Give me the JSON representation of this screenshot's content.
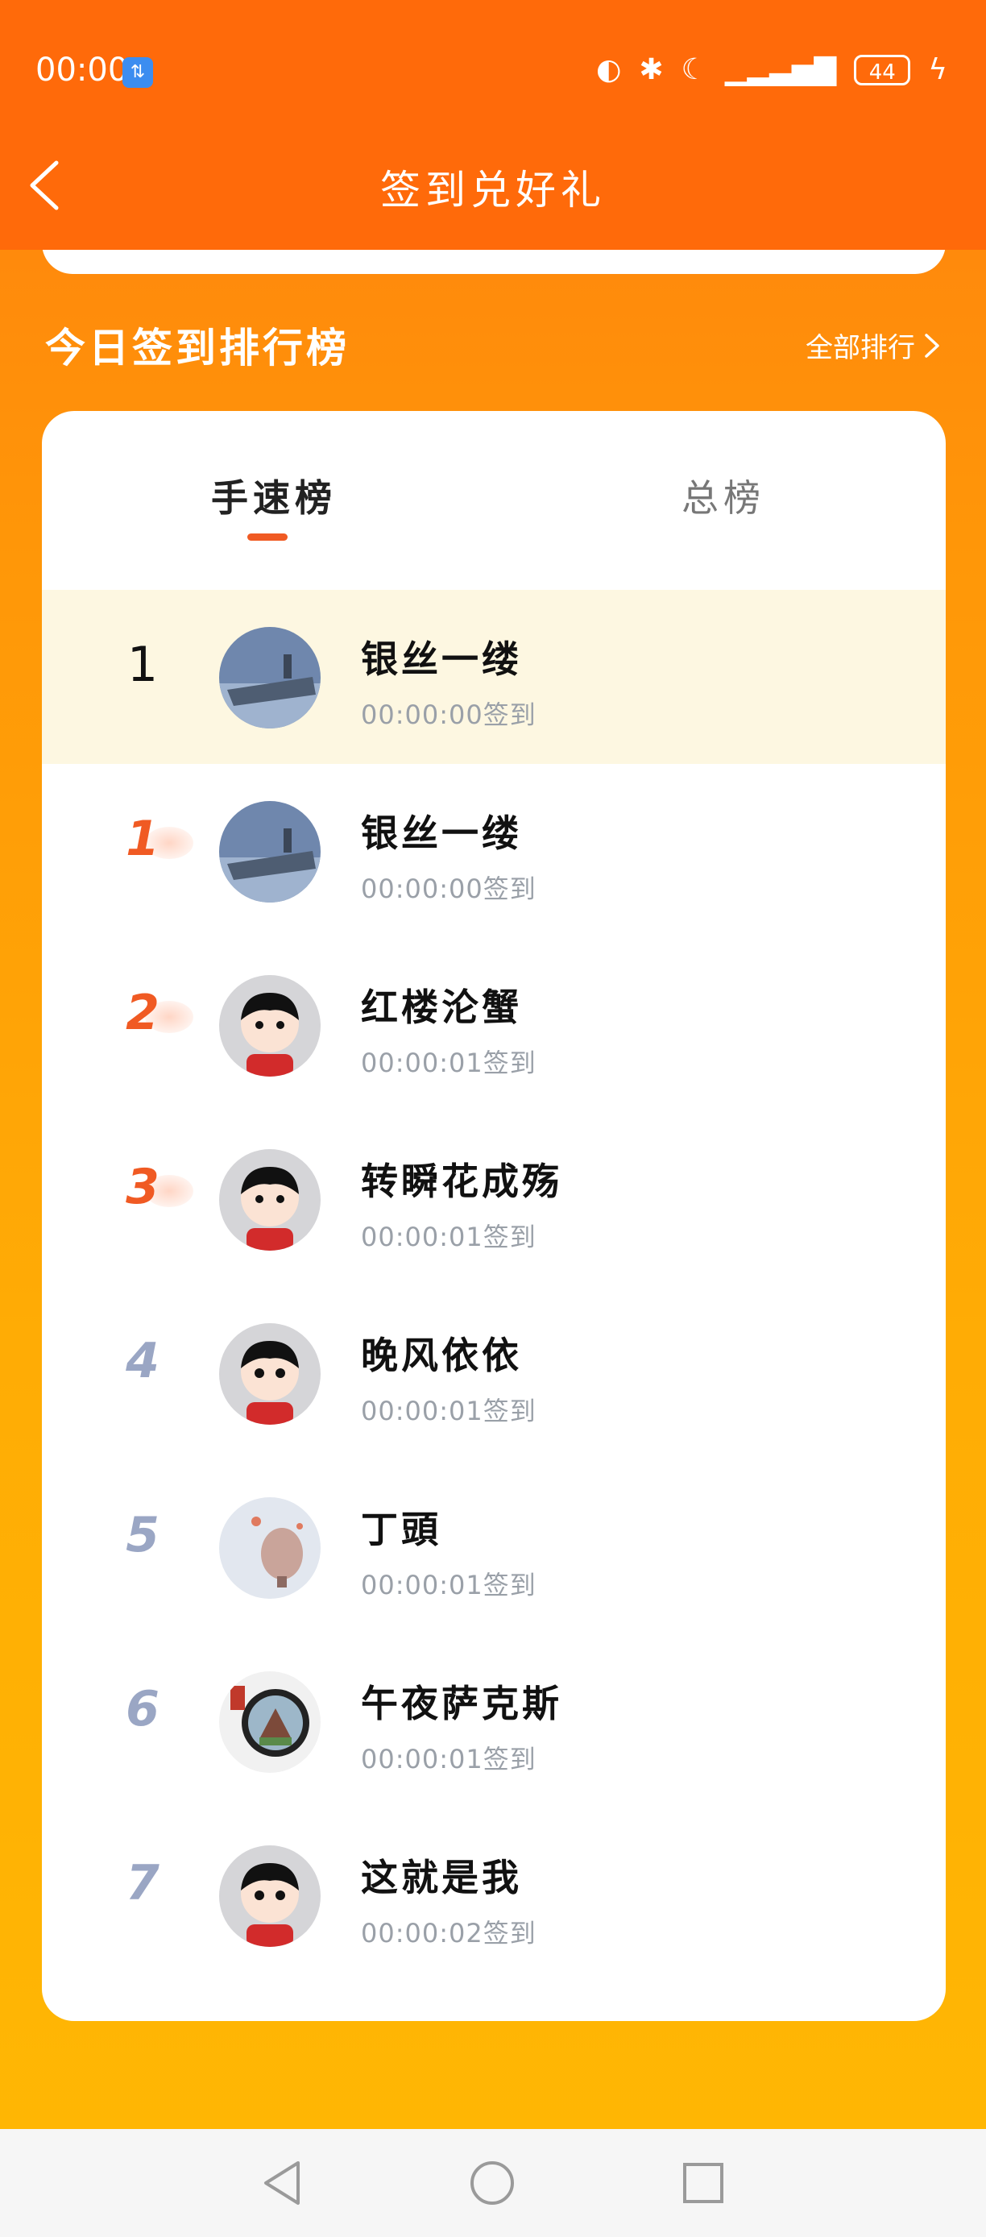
{
  "status": {
    "time": "00:00",
    "battery": "44"
  },
  "header": {
    "title": "签到兑好礼"
  },
  "ranking": {
    "title": "今日签到排行榜",
    "all_label": "全部排行",
    "tabs": [
      {
        "label": "手速榜"
      },
      {
        "label": "总榜"
      }
    ],
    "rows": [
      {
        "rank": "1",
        "name": "银丝一缕",
        "time": "00:00:00签到"
      },
      {
        "rank": "1",
        "name": "银丝一缕",
        "time": "00:00:00签到"
      },
      {
        "rank": "2",
        "name": "红楼沦蟹",
        "time": "00:00:01签到"
      },
      {
        "rank": "3",
        "name": "转瞬花成殇",
        "time": "00:00:01签到"
      },
      {
        "rank": "4",
        "name": "晚风依依",
        "time": "00:00:01签到"
      },
      {
        "rank": "5",
        "name": "丁頭",
        "time": "00:00:01签到"
      },
      {
        "rank": "6",
        "name": "午夜萨克斯",
        "time": "00:00:01签到"
      },
      {
        "rank": "7",
        "name": "这就是我",
        "time": "00:00:02签到"
      }
    ]
  }
}
